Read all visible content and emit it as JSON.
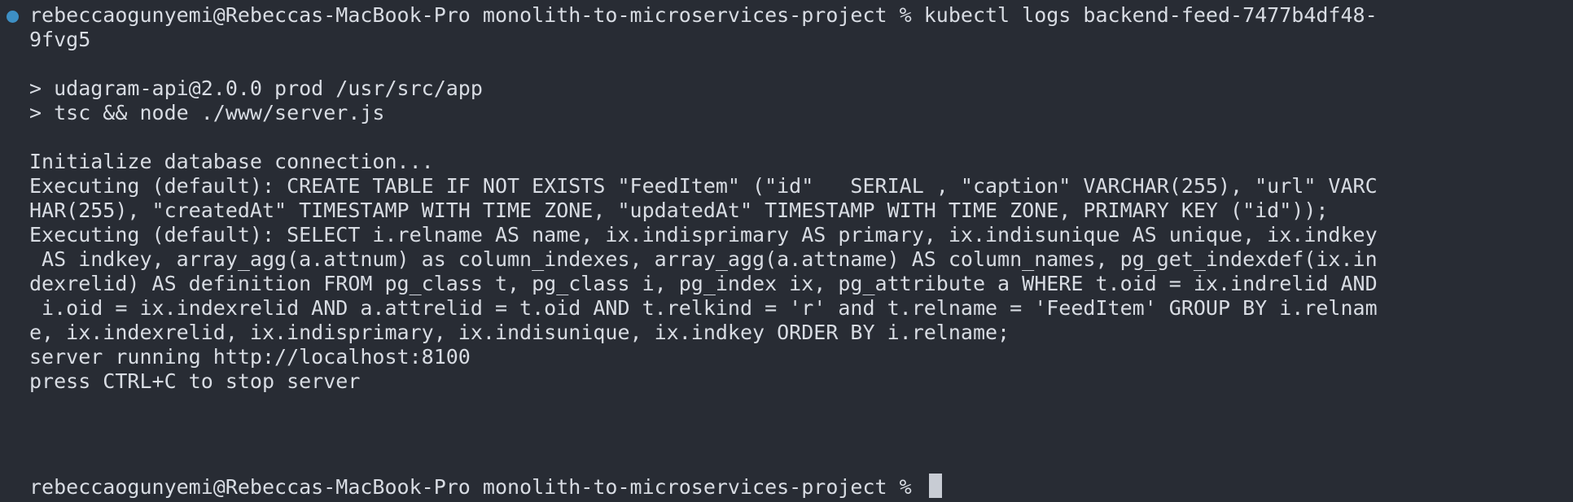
{
  "terminal": {
    "lines": [
      "rebeccaogunyemi@Rebeccas-MacBook-Pro monolith-to-microservices-project % kubectl logs backend-feed-7477b4df48-",
      "9fvg5",
      "",
      "> udagram-api@2.0.0 prod /usr/src/app",
      "> tsc && node ./www/server.js",
      "",
      "Initialize database connection...",
      "Executing (default): CREATE TABLE IF NOT EXISTS \"FeedItem\" (\"id\"   SERIAL , \"caption\" VARCHAR(255), \"url\" VARC",
      "HAR(255), \"createdAt\" TIMESTAMP WITH TIME ZONE, \"updatedAt\" TIMESTAMP WITH TIME ZONE, PRIMARY KEY (\"id\"));",
      "Executing (default): SELECT i.relname AS name, ix.indisprimary AS primary, ix.indisunique AS unique, ix.indkey",
      " AS indkey, array_agg(a.attnum) as column_indexes, array_agg(a.attname) AS column_names, pg_get_indexdef(ix.in",
      "dexrelid) AS definition FROM pg_class t, pg_class i, pg_index ix, pg_attribute a WHERE t.oid = ix.indrelid AND",
      " i.oid = ix.indexrelid AND a.attrelid = t.oid AND t.relkind = 'r' and t.relname = 'FeedItem' GROUP BY i.relnam",
      "e, ix.indexrelid, ix.indisprimary, ix.indisunique, ix.indkey ORDER BY i.relname;",
      "server running http://localhost:8100",
      "press CTRL+C to stop server",
      "rebeccaogunyemi@Rebeccas-MacBook-Pro monolith-to-microservices-project % "
    ]
  },
  "colors": {
    "background": "#282c34",
    "text": "#d8dce3",
    "prompt_marker": "#3d8fc4"
  }
}
